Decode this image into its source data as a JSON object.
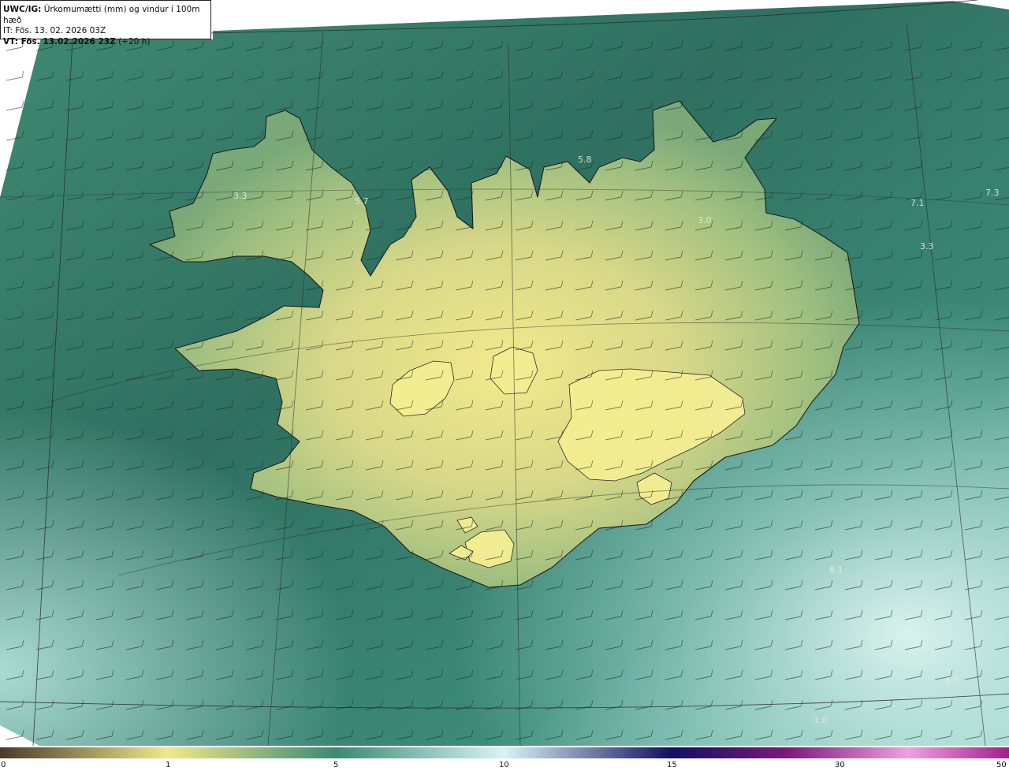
{
  "header": {
    "product": "UWC/IG:",
    "title": "Úrkomumætti (mm) og vindur í 100m hæð",
    "it_line": "IT: Fös. 13. 02. 2026 03Z",
    "vt_bold": "VT: Fös. 13.02.2026 23Z",
    "vt_offset": "(+20 h)"
  },
  "colorbar": {
    "ticks": [
      "0",
      "1",
      "5",
      "10",
      "15",
      "30",
      "50"
    ],
    "colors": [
      "#4a3a2a",
      "#b8a86a",
      "#f0e88a",
      "#3a8a72",
      "#d8f4f4",
      "#101060",
      "#7a1a7a",
      "#f0a0e0",
      "#a0208a"
    ]
  },
  "map_values": [
    {
      "id": "nw-3-3",
      "text": "3.3"
    },
    {
      "id": "nw-5-7",
      "text": "5.7"
    },
    {
      "id": "n-5-8",
      "text": "5.8"
    },
    {
      "id": "ne-3-0",
      "text": "3.0"
    },
    {
      "id": "ne-7-1",
      "text": "7.1"
    },
    {
      "id": "ne-7-3",
      "text": "7.3"
    },
    {
      "id": "e-3-3",
      "text": "3.3"
    },
    {
      "id": "se-8-1",
      "text": "8.1"
    },
    {
      "id": "se-6-0",
      "text": "6.0"
    },
    {
      "id": "s-1-0",
      "text": "1.0"
    }
  ]
}
